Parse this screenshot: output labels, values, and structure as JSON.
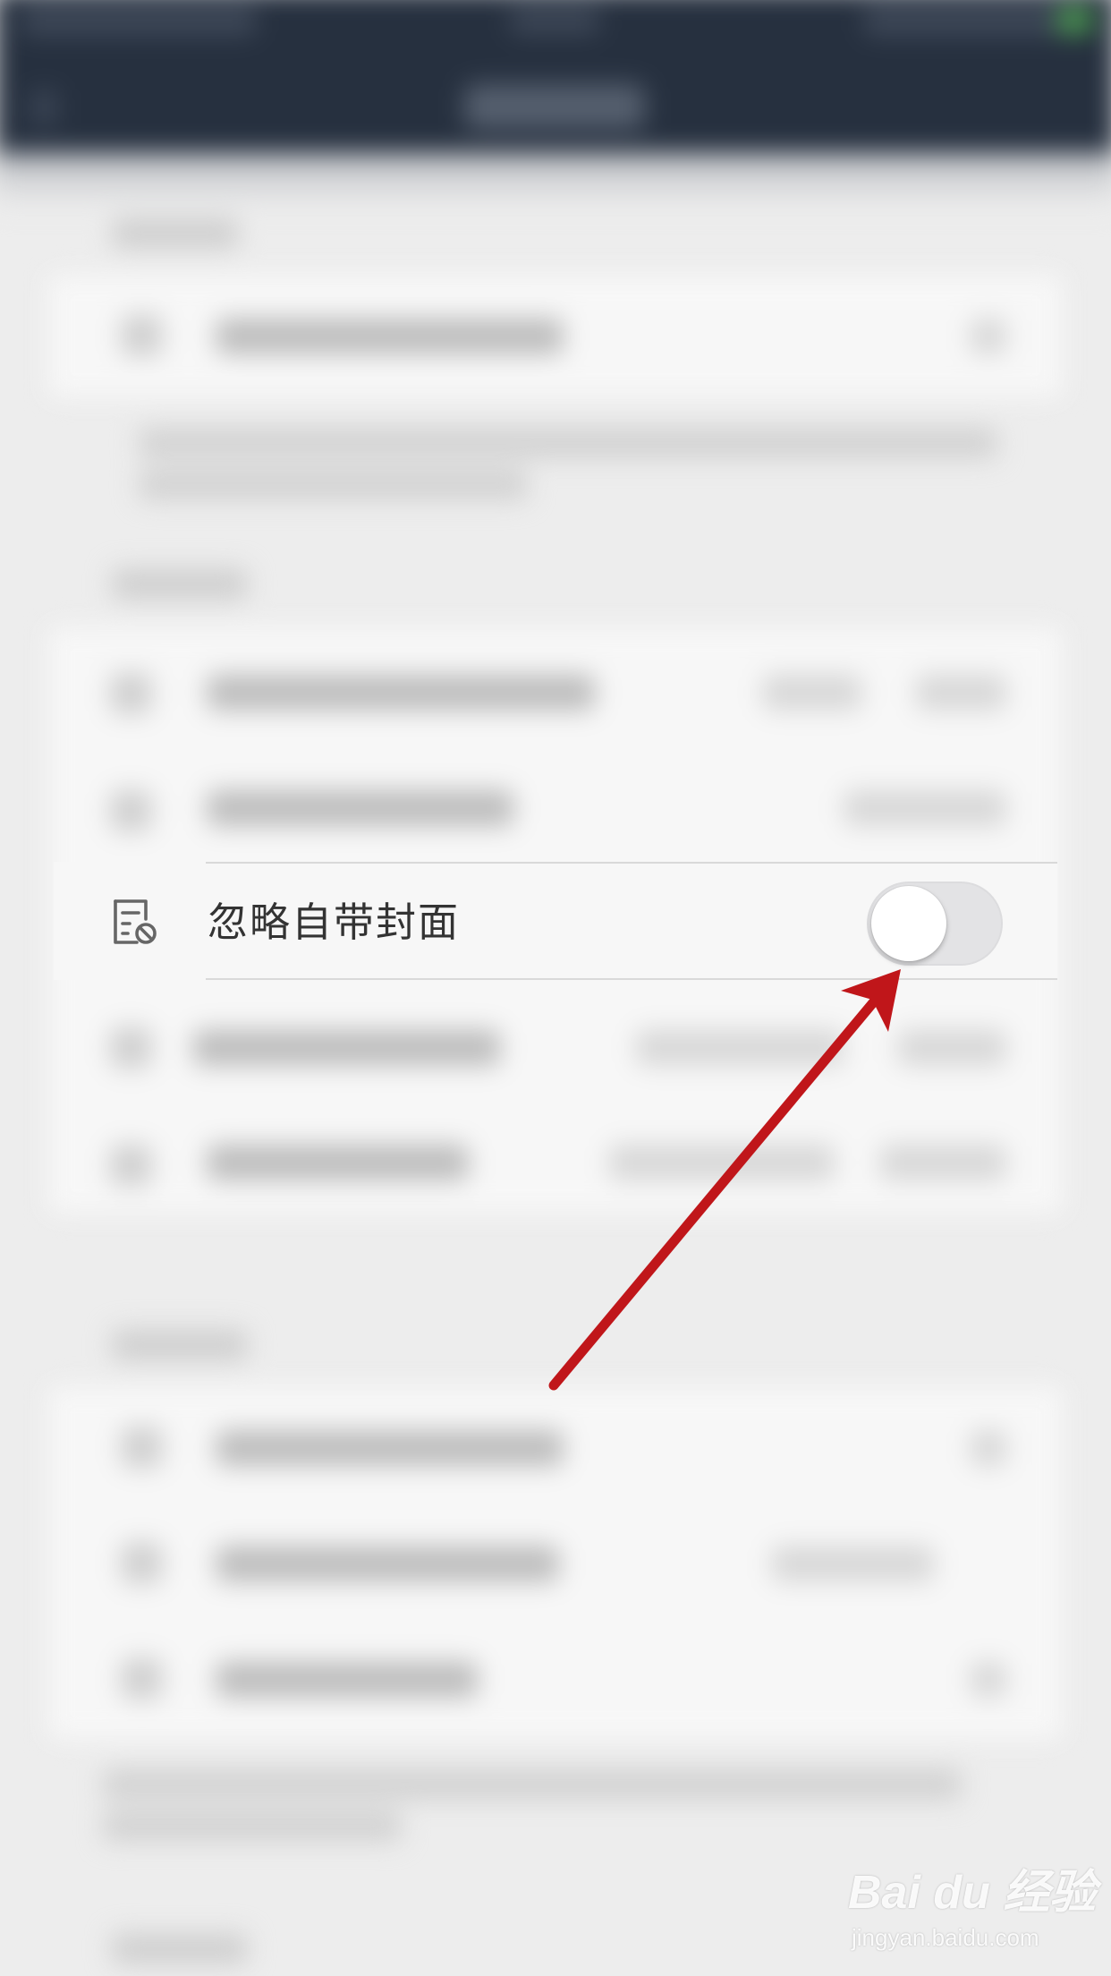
{
  "setting_row": {
    "icon": "ignore-cover-icon",
    "label": "忽略自带封面",
    "toggle_on": false
  },
  "annotation": {
    "type": "arrow",
    "color": "#c0161a"
  },
  "watermark": {
    "logo_text": "Bai du 经验",
    "url": "jingyan.baidu.com"
  },
  "colors": {
    "top_bar": "#26303f",
    "row_background": "#f7f7f7",
    "toggle_off_track": "#e3e3e5",
    "arrow": "#c0161a"
  }
}
